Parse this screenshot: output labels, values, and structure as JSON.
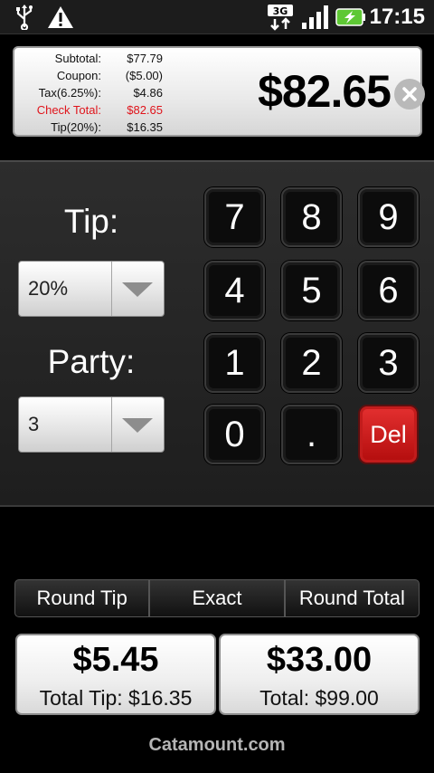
{
  "status_bar": {
    "time": "17:15",
    "network": "3G",
    "icons": [
      "usb-icon",
      "warning-icon",
      "3g-icon",
      "signal-icon",
      "battery-charging-icon"
    ],
    "battery_color": "#5ec834"
  },
  "summary": {
    "rows": [
      {
        "label": "Subtotal:",
        "value": "$77.79"
      },
      {
        "label": "Coupon:",
        "value": "($5.00)"
      },
      {
        "label": "Tax(6.25%):",
        "value": "$4.86"
      },
      {
        "label": "Check Total:",
        "value": "$82.65"
      },
      {
        "label": "Tip(20%):",
        "value": "$16.35"
      }
    ],
    "highlight_color": "#e0141b",
    "total": "$82.65"
  },
  "inputs": {
    "tip_label": "Tip:",
    "tip_value": "20%",
    "party_label": "Party:",
    "party_value": "3"
  },
  "keypad": {
    "keys": [
      "7",
      "8",
      "9",
      "4",
      "5",
      "6",
      "1",
      "2",
      "3",
      "0",
      ".",
      "Del"
    ],
    "delete_color": "#d11f1f"
  },
  "rounding": {
    "options": [
      "Round Tip",
      "Exact",
      "Round Total"
    ]
  },
  "results": {
    "per_person_tip": "$5.45",
    "total_tip": "Total Tip: $16.35",
    "per_person_total": "$33.00",
    "total": "Total: $99.00"
  },
  "footer": "Catamount.com"
}
